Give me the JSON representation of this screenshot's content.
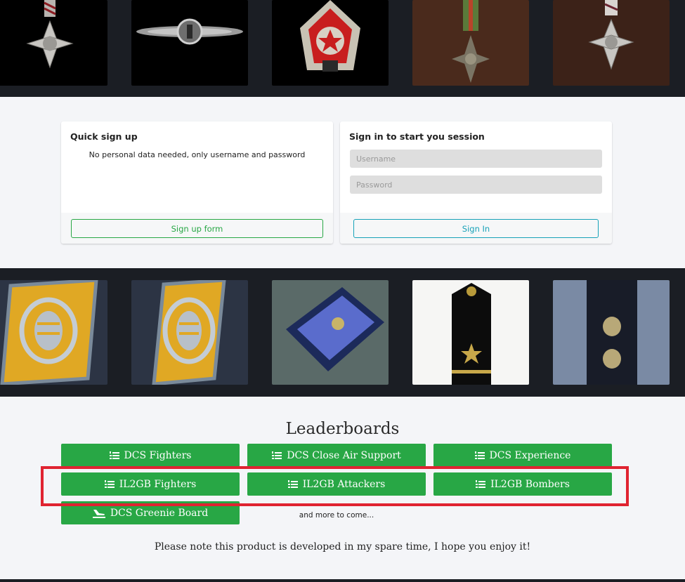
{
  "top_gallery": {
    "items": [
      {
        "name": "distinguished-flying-cross-medal"
      },
      {
        "name": "luftwaffe-clasp-badge"
      },
      {
        "name": "order-of-red-banner-medal"
      },
      {
        "name": "croix-de-guerre-medal"
      },
      {
        "name": "air-force-cross-medal"
      }
    ]
  },
  "quick_signup": {
    "title": "Quick sign up",
    "description": "No personal data needed, only username and password",
    "button_label": "Sign up form"
  },
  "signin": {
    "title": "Sign in to start you session",
    "username_placeholder": "Username",
    "password_placeholder": "Password",
    "button_label": "Sign In"
  },
  "mid_gallery": {
    "items": [
      {
        "name": "luftwaffe-collar-tab-1"
      },
      {
        "name": "luftwaffe-collar-tab-2"
      },
      {
        "name": "soviet-collar-patch"
      },
      {
        "name": "naval-shoulder-board"
      },
      {
        "name": "oak-leaf-shoulder-board"
      }
    ]
  },
  "leaderboards": {
    "title": "Leaderboards",
    "buttons": [
      {
        "label": "DCS Fighters",
        "icon": "list-ol-icon"
      },
      {
        "label": "DCS Close Air Support",
        "icon": "list-ol-icon"
      },
      {
        "label": "DCS Experience",
        "icon": "list-ol-icon"
      },
      {
        "label": "IL2GB Fighters",
        "icon": "list-ol-icon"
      },
      {
        "label": "IL2GB Attackers",
        "icon": "list-ol-icon"
      },
      {
        "label": "IL2GB Bombers",
        "icon": "list-ol-icon"
      },
      {
        "label": "DCS Greenie Board",
        "icon": "plane-landing-icon"
      }
    ],
    "more_text": "and more to come..."
  },
  "footer_note": "Please note this product is developed in my spare time, I hope you enjoy it!",
  "colors": {
    "dark_strip": "#1b1e24",
    "page_bg": "#f4f5f8",
    "button_green": "#28a745",
    "outline_teal": "#17a2b8",
    "highlight_red": "#e02331"
  }
}
